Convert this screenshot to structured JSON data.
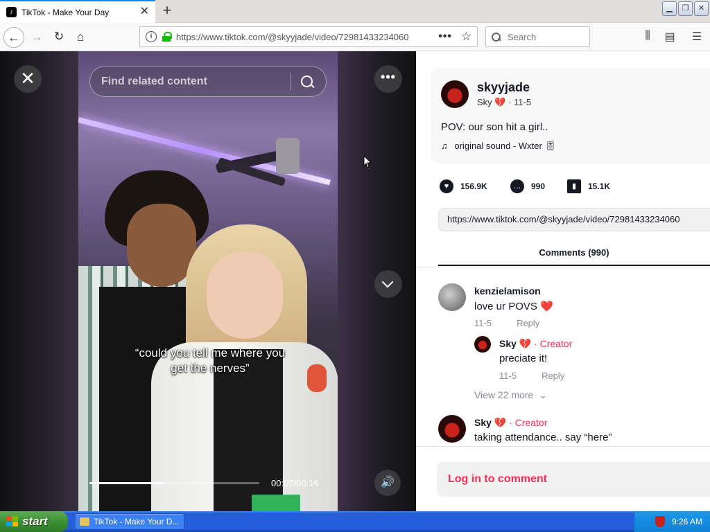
{
  "browser": {
    "tab_title": "TikTok - Make Your Day",
    "url": "https://www.tiktok.com/@skyyjade/video/72981433234060",
    "search_placeholder": "Search"
  },
  "video": {
    "find_placeholder": "Find related content",
    "caption_line1": "“could you tell me where you",
    "caption_line2": "get the nerves”",
    "time": "00:07/00:16",
    "progress_fraction": 0.4375
  },
  "post": {
    "author": "skyyjade",
    "author_sub": "Sky 💔 · 11-5",
    "description": "POV: our son hit a girl..",
    "music": "original sound - Wxter 🎚",
    "likes": "156.9K",
    "comments": "990",
    "saves": "15.1K",
    "link": "https://www.tiktok.com/@skyyjade/video/72981433234060"
  },
  "comments_section": {
    "tab_label": "Comments (990)",
    "items": [
      {
        "user": "kenzielamison",
        "text": "love ur POVS ❤️",
        "date": "11-5",
        "reply": "Reply"
      },
      {
        "user": "Sky 💔",
        "creator": "· Creator",
        "text": "preciate it!",
        "date": "11-5",
        "reply": "Reply"
      },
      {
        "user": "Sky 💔",
        "creator": "· Creator",
        "text": "taking attendance.. say “here”"
      }
    ],
    "view_more": "View 22 more",
    "login_prompt": "Log in to comment"
  },
  "taskbar": {
    "start_label": "start",
    "task_label": "TikTok - Make Your D...",
    "clock": "9:26 AM"
  },
  "colors": {
    "tiktok_red": "#fe2c55",
    "xp_blue": "#245edb",
    "xp_green": "#3c8f33"
  }
}
